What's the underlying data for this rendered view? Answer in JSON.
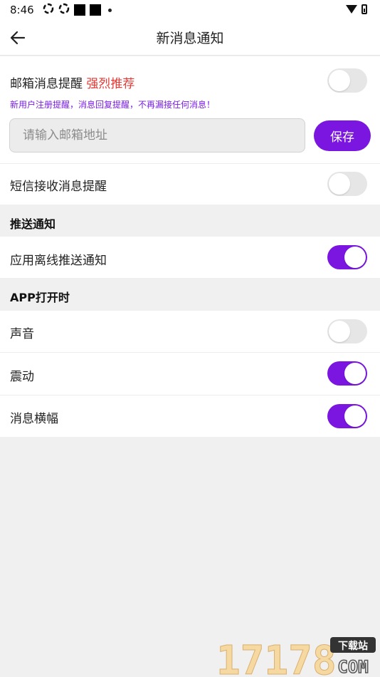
{
  "status_bar": {
    "time": "8:46"
  },
  "header": {
    "title": "新消息通知"
  },
  "email": {
    "label": "邮箱消息提醒",
    "recommend": "强烈推荐",
    "hint": "新用户注册提醒，消息回复提醒，不再漏接任何消息！",
    "placeholder": "请输入邮箱地址",
    "save_label": "保存",
    "toggle_on": false
  },
  "sms": {
    "label": "短信接收消息提醒",
    "toggle_on": false
  },
  "push_section": {
    "title": "推送通知"
  },
  "push": {
    "label": "应用离线推送通知",
    "toggle_on": true
  },
  "app_open_section": {
    "title": "APP打开时"
  },
  "app_open_items": [
    {
      "label": "声音",
      "toggle_on": false
    },
    {
      "label": "震动",
      "toggle_on": true
    },
    {
      "label": "消息横幅",
      "toggle_on": true
    }
  ],
  "watermark": {
    "number": "17178",
    "tag": "下载站",
    "suffix": "COM"
  },
  "colors": {
    "accent": "#7a16e0",
    "recommend_red": "#e53935",
    "hint_purple": "#7a1de6"
  }
}
